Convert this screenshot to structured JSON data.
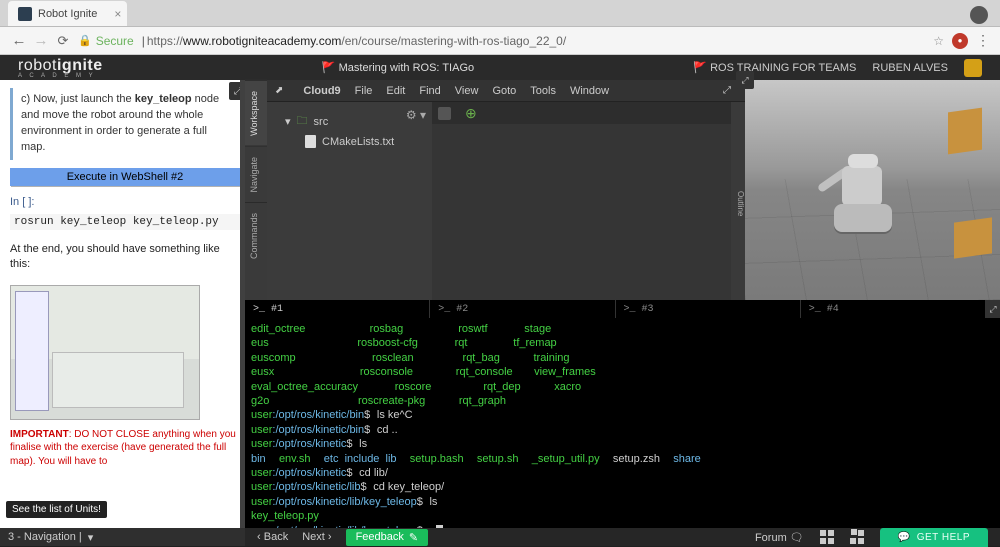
{
  "browser": {
    "tab_title": "Robot Ignite",
    "secure_label": "Secure",
    "url_prefix": "https://",
    "url_domain": "www.robotigniteacademy.com",
    "url_path": "/en/course/mastering-with-ros-tiago_22_0/"
  },
  "header": {
    "logo_a": "robot",
    "logo_b": "ignite",
    "logo_sub": "A C A D E M Y",
    "course_icon": "🚩",
    "course_title": "Mastering with ROS: TIAGo",
    "teams_icon": "🚩",
    "teams_label": "ROS TRAINING FOR TEAMS",
    "user_name": "RUBEN ALVES"
  },
  "left_panel": {
    "instr_html_prefix": "c) Now, just launch the ",
    "instr_bold": "key_teleop",
    "instr_html_suffix": " node and move the robot around the whole environment in order to generate a full map.",
    "exec_button": "Execute in WebShell #2",
    "cell_prompt": "In [ ]:",
    "cell_code": "rosrun key_teleop key_teleop.py",
    "after_text": "At the end, you should have something like this:",
    "important_label": "IMPORTANT",
    "important_rest": ": DO NOT CLOSE anything when you finalise with the exercise (have generated the full map). You will have to",
    "tooltip": "See the list of Units!"
  },
  "ide": {
    "menu": [
      "Cloud9",
      "File",
      "Edit",
      "Find",
      "View",
      "Goto",
      "Tools",
      "Window"
    ],
    "side_tabs": [
      "Workspace",
      "Navigate",
      "Commands"
    ],
    "tree_folder": "src",
    "tree_file": "CMakeLists.txt",
    "outline_label": "Outline"
  },
  "terminal": {
    "tabs": [
      ">_ #1",
      ">_ #2",
      ">_ #3",
      ">_ #4"
    ],
    "col1": [
      "edit_octree",
      "eus",
      "euscomp",
      "eusx",
      "eval_octree_accuracy",
      "g2o"
    ],
    "col2": [
      "rosbag",
      "rosboost-cfg",
      "rosclean",
      "rosconsole",
      "roscore",
      "roscreate-pkg"
    ],
    "col3": [
      "roswtf",
      "rqt",
      "rqt_bag",
      "rqt_console",
      "rqt_dep",
      "rqt_graph"
    ],
    "col4": [
      "stage",
      "tf_remap",
      "training",
      "view_frames",
      "xacro"
    ],
    "lines": {
      "l1_prompt": "user:/opt/ros/kinetic/bin$",
      "l1_cmd": "ls ke^C",
      "l2_prompt": "user:/opt/ros/kinetic/bin$",
      "l2_cmd": "cd ..",
      "l3_prompt": "user:/opt/ros/kinetic$",
      "l3_cmd": "ls",
      "dir_row": "bin  env.sh  etc  include  lib  setup.bash  setup.sh  _setup_util.py  setup.zsh  share",
      "l4_prompt": "user:/opt/ros/kinetic$",
      "l4_cmd": "cd lib/",
      "l5_prompt": "user:/opt/ros/kinetic/lib$",
      "l5_cmd": "cd key_teleop/",
      "l6_prompt": "user:/opt/ros/kinetic/lib/key_teleop$",
      "l6_cmd": "ls",
      "l7_out": "key_teleop.py",
      "l8_prompt": "user:/opt/ros/kinetic/lib/key_teleop$"
    }
  },
  "bottom": {
    "left_label": "3 - Navigation |",
    "back": "Back",
    "next": "Next",
    "feedback": "Feedback",
    "forum": "Forum",
    "get_help": "GET HELP"
  }
}
